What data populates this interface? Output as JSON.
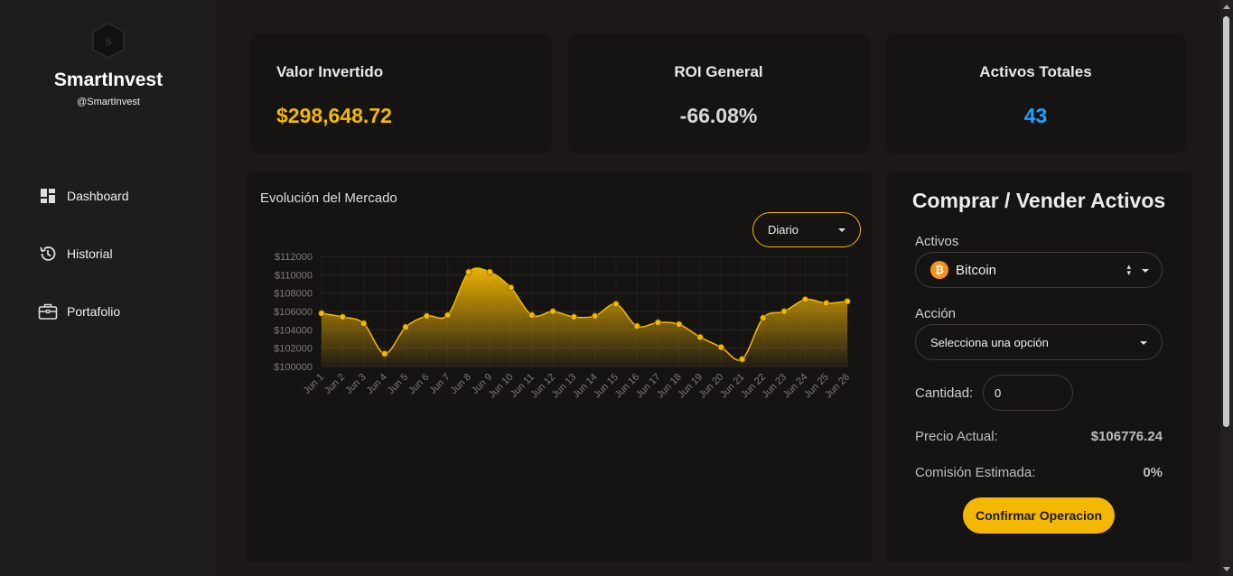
{
  "sidebar": {
    "brand": "SmartInvest",
    "handle": "@SmartInvest",
    "logo_letter": "S",
    "items": [
      {
        "label": "Dashboard",
        "icon": "dashboard-icon"
      },
      {
        "label": "Historial",
        "icon": "history-icon"
      },
      {
        "label": "Portafolio",
        "icon": "briefcase-icon"
      }
    ]
  },
  "stats": [
    {
      "title": "Valor Invertido",
      "value": "$298,648.72",
      "color": "#f5b800"
    },
    {
      "title": "ROI General",
      "value": "-66.08%",
      "color": "#d8d8d8"
    },
    {
      "title": "Activos Totales",
      "value": "43",
      "color": "#1aa3ff"
    }
  ],
  "chart": {
    "title": "Evolución del Mercado",
    "range": "Diario"
  },
  "chart_data": {
    "type": "area",
    "x": [
      "Jun 1",
      "Jun 2",
      "Jun 3",
      "Jun 4",
      "Jun 5",
      "Jun 6",
      "Jun 7",
      "Jun 8",
      "Jun 9",
      "Jun 10",
      "Jun 11",
      "Jun 12",
      "Jun 13",
      "Jun 14",
      "Jun 15",
      "Jun 16",
      "Jun 17",
      "Jun 18",
      "Jun 19",
      "Jun 20",
      "Jun 21",
      "Jun 22",
      "Jun 23",
      "Jun 24",
      "Jun 25",
      "Jun 26"
    ],
    "series": [
      {
        "values": [
          105800,
          105400,
          104700,
          101400,
          104300,
          105500,
          105600,
          110300,
          110300,
          108600,
          105600,
          106000,
          105400,
          105500,
          106800,
          104400,
          104800,
          104600,
          103200,
          102100,
          100800,
          105300,
          106000,
          107300,
          106900,
          107100
        ]
      }
    ],
    "ylim": [
      100000,
      112000
    ],
    "yticks": [
      "$100000",
      "$102000",
      "$104000",
      "$106000",
      "$108000",
      "$110000",
      "$112000"
    ],
    "color": "#f5b800",
    "grid": true,
    "legend": "none"
  },
  "trade": {
    "title": "Comprar / Vender Activos",
    "asset_label": "Activos",
    "asset_value": "Bitcoin",
    "asset_icon_letter": "₿",
    "action_label": "Acción",
    "action_placeholder": "Selecciona una opción",
    "quantity_label": "Cantidad:",
    "quantity_value": "0",
    "price_label": "Precio Actual:",
    "price_value": "$106776.24",
    "fee_label": "Comisión Estimada:",
    "fee_value": "0%",
    "confirm_label": "Confirmar Operacion"
  }
}
